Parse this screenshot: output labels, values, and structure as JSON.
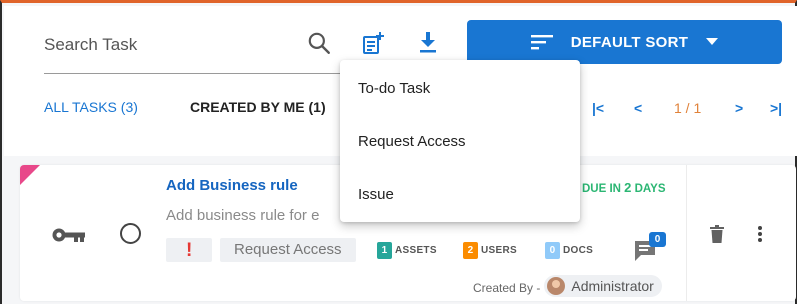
{
  "search": {
    "placeholder": "Search Task"
  },
  "toolbar": {
    "sort_label": "DEFAULT SORT"
  },
  "tabs": [
    {
      "label": "ALL TASKS (3)"
    },
    {
      "label": "CREATED BY ME (1)"
    }
  ],
  "pagination": {
    "first": "|<",
    "prev": "<",
    "page_text": "1 / 1",
    "next": ">",
    "last": ">|"
  },
  "dropdown": {
    "items": [
      "To-do Task",
      "Request Access",
      "Issue"
    ]
  },
  "task": {
    "title": "Add Business rule",
    "description": "Add business rule for e",
    "due_prefix": "DUE IN ",
    "due_num": "2",
    "due_suffix": " DAYS",
    "priority_mark": "!",
    "type": "Request Access",
    "assets_count": "1",
    "assets_label": "ASSETS",
    "users_count": "2",
    "users_label": "USERS",
    "docs_count": "0",
    "docs_label": "DOCS",
    "comments_count": "0",
    "created_by_label": "Created By -",
    "creator": "Administrator"
  },
  "colors": {
    "accent": "#1976d2",
    "top_border": "#e0642a",
    "due": "#2bb673",
    "priority": "#e53935",
    "assets_badge": "#26a69a",
    "users_badge": "#fb8c00",
    "docs_badge": "#90caf9",
    "flag": "#e8488a"
  }
}
